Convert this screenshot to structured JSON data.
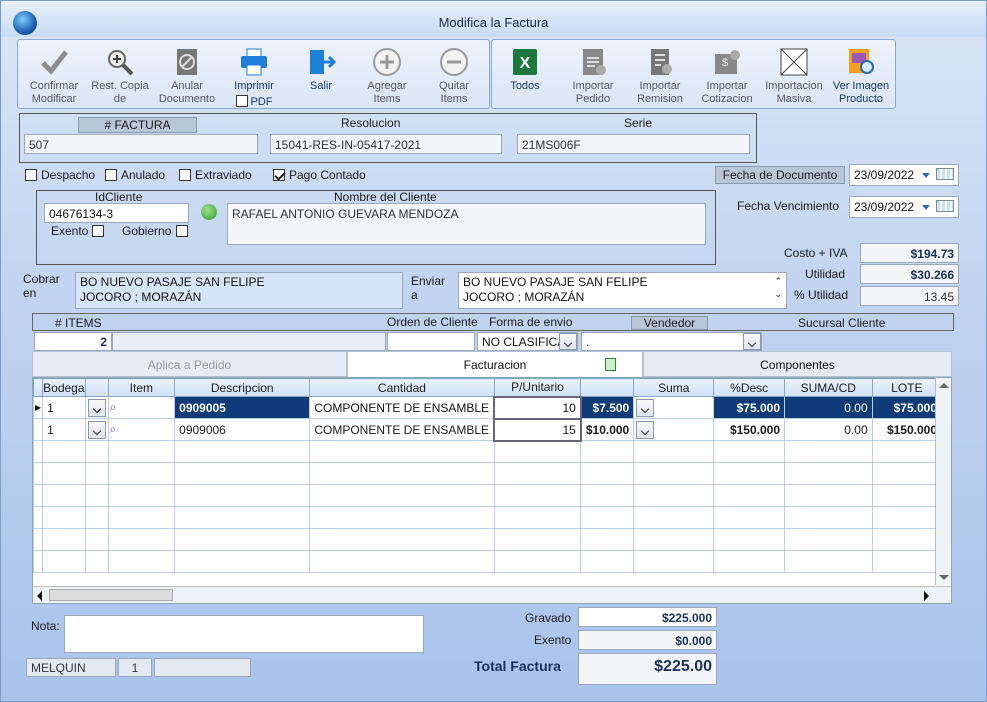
{
  "window": {
    "title": "Modifica la Factura"
  },
  "toolbar": {
    "items": [
      {
        "l1": "Confirmar",
        "l2": "Modificar",
        "icon": "checkmark-icon"
      },
      {
        "l1": "Rest. Copia",
        "l2": "de",
        "icon": "zoom-icon"
      },
      {
        "l1": "Anular",
        "l2": "Documento",
        "icon": "cancel-doc-icon"
      },
      {
        "l1": "Imprimir",
        "l2": "PDF",
        "icon": "printer-icon"
      },
      {
        "l1": "Salir",
        "l2": "",
        "icon": "exit-icon"
      },
      {
        "l1": "Agregar",
        "l2": "Items",
        "icon": "plus-circle-icon"
      },
      {
        "l1": "Quitar",
        "l2": "Items",
        "icon": "minus-circle-icon"
      },
      {
        "l1": "Todos",
        "l2": "",
        "icon": "excel-icon"
      },
      {
        "l1": "Importar",
        "l2": "Pedido",
        "icon": "import-order-icon"
      },
      {
        "l1": "Importar",
        "l2": "Remision",
        "icon": "import-remission-icon"
      },
      {
        "l1": "Importar",
        "l2": "Cotizacion",
        "icon": "import-quote-icon"
      },
      {
        "l1": "Importacion",
        "l2": "Masiva",
        "icon": "mass-import-icon"
      },
      {
        "l1": "Ver Imagen",
        "l2": "Producto",
        "icon": "view-image-icon"
      }
    ]
  },
  "invoice": {
    "factura_label": "# FACTURA",
    "factura": "507",
    "resolucion_label": "Resolucion",
    "resolucion": "15041-RES-IN-05417-2021",
    "serie_label": "Serie",
    "serie": "21MS006F"
  },
  "flags": {
    "despacho": "Despacho",
    "anulado": "Anulado",
    "extraviado": "Extraviado",
    "pago": "Pago Contado"
  },
  "dates": {
    "fecha_doc_label": "Fecha de  Documento",
    "fecha_doc": "23/09/2022",
    "fecha_venc_label": "Fecha Vencimiento",
    "fecha_venc": "23/09/2022"
  },
  "client": {
    "id_label": "IdCliente",
    "id": "04676134-3",
    "nombre_label": "Nombre del Cliente",
    "nombre": "RAFAEL ANTONIO GUEVARA MENDOZA",
    "exento": "Exento",
    "gobierno": "Gobierno"
  },
  "address": {
    "cobrar_label1": "Cobrar",
    "cobrar_label2": "en",
    "cobrar_1": "BO NUEVO PASAJE SAN FELIPE",
    "cobrar_2": "JOCORO ; MORAZÁN",
    "enviar_label1": "Enviar",
    "enviar_label2": "a",
    "enviar_1": "BO NUEVO PASAJE SAN FELIPE",
    "enviar_2": "JOCORO ; MORAZÁN"
  },
  "costs": {
    "costo_label": "Costo + IVA",
    "costo": "$194.73",
    "util_label": "Utilidad",
    "util": "$30.266",
    "putil_label": "% Utilidad",
    "putil": "13.45"
  },
  "meta": {
    "items_label": "# ITEMS",
    "items": "2",
    "orden_label": "Orden de Cliente",
    "forma_label": "Forma de envio",
    "forma": "NO CLASIFICA",
    "vendedor_label": "Vendedor",
    "vendedor": ".",
    "sucursal_label": "Sucursal Cliente"
  },
  "tabs": {
    "t1": "Aplica a Pedido",
    "t2": "Facturacion",
    "t3": "Componentes"
  },
  "grid": {
    "headers": [
      "Bodega",
      "",
      "Item",
      "Descripcion",
      "Cantidad",
      "P/Unitario",
      "",
      "Suma",
      "%Desc",
      "SUMA/CD",
      "LOTE"
    ],
    "rows": [
      {
        "bodega": "1",
        "item": "0909005",
        "desc": "COMPONENTE DE ENSAMBLE",
        "cant": "10",
        "pu": "$7.500",
        "suma": "$75.000",
        "desc_pct": "0.00",
        "sumacd": "$75.000"
      },
      {
        "bodega": "1",
        "item": "0909006",
        "desc": "COMPONENTE DE ENSAMBLE",
        "cant": "15",
        "pu": "$10.000",
        "suma": "$150.000",
        "desc_pct": "0.00",
        "sumacd": "$150.000"
      }
    ]
  },
  "totals": {
    "nota_label": "Nota:",
    "gravado_label": "Gravado",
    "gravado": "$225.000",
    "exento_label": "Exento",
    "exento": "$0.000",
    "total_label": "Total Factura",
    "total": "$225.00"
  },
  "status": {
    "user": "MELQUIN",
    "n": "1"
  }
}
